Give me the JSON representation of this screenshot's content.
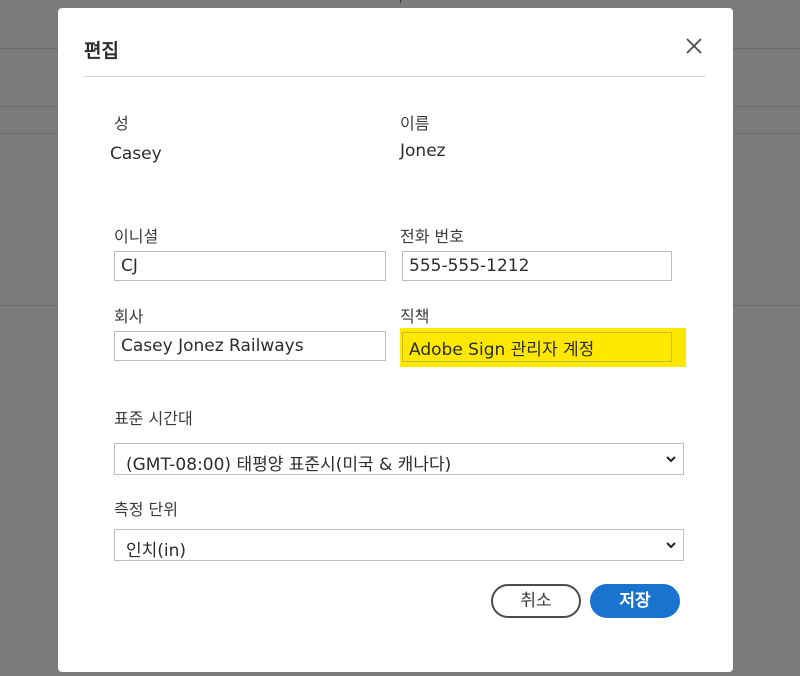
{
  "dialog": {
    "title": "편집",
    "close_icon": "close-icon"
  },
  "fields": {
    "last_name_label": "성",
    "last_name_value": "Casey",
    "first_name_label": "이름",
    "first_name_value": "Jonez",
    "initials_label": "이니셜",
    "initials_value": "CJ",
    "phone_label": "전화 번호",
    "phone_value": "555-555-1212",
    "company_label": "회사",
    "company_value": "Casey Jonez Railways",
    "title_label": "직책",
    "title_value": "Adobe Sign 관리자 계정",
    "timezone_label": "표준 시간대",
    "timezone_value": "(GMT-08:00) 태평양 표준시(미국 & 캐나다)",
    "units_label": "측정 단위",
    "units_value": "인치(in)"
  },
  "buttons": {
    "cancel": "취소",
    "save": "저장"
  },
  "colors": {
    "save_button": "#1b73d0",
    "highlight": "#ffe800",
    "overlay": "#7b7b7b"
  }
}
